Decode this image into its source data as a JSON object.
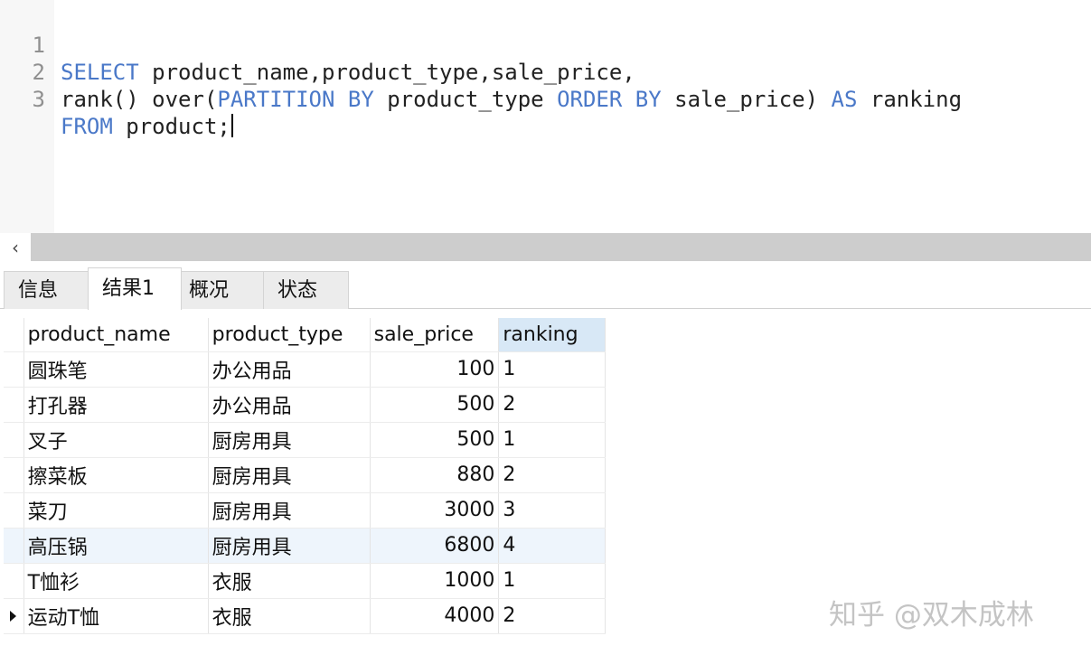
{
  "editor": {
    "lines": [
      {
        "number": "1",
        "tokens": [
          {
            "t": "SELECT",
            "kw": true
          },
          {
            "t": " product_name,product_type,sale_price,",
            "kw": false
          }
        ]
      },
      {
        "number": "2",
        "tokens": [
          {
            "t": "rank() over(",
            "kw": false
          },
          {
            "t": "PARTITION BY",
            "kw": true
          },
          {
            "t": " product_type ",
            "kw": false
          },
          {
            "t": "ORDER BY",
            "kw": true
          },
          {
            "t": " sale_price) ",
            "kw": false
          },
          {
            "t": "AS",
            "kw": true
          },
          {
            "t": " ranking",
            "kw": false
          }
        ]
      },
      {
        "number": "3",
        "tokens": [
          {
            "t": "FROM",
            "kw": true
          },
          {
            "t": " product;",
            "kw": false
          }
        ]
      }
    ]
  },
  "scrollbar": {
    "left_arrow": "‹"
  },
  "tabs": {
    "info": "信息",
    "result": "结果1",
    "overview": "概况",
    "status": "状态"
  },
  "grid": {
    "columns": [
      "product_name",
      "product_type",
      "sale_price",
      "ranking"
    ],
    "rows": [
      [
        "圆珠笔",
        "办公用品",
        "100",
        "1"
      ],
      [
        "打孔器",
        "办公用品",
        "500",
        "2"
      ],
      [
        "叉子",
        "厨房用具",
        "500",
        "1"
      ],
      [
        "擦菜板",
        "厨房用具",
        "880",
        "2"
      ],
      [
        "菜刀",
        "厨房用具",
        "3000",
        "3"
      ],
      [
        "高压锅",
        "厨房用具",
        "6800",
        "4"
      ],
      [
        "T恤衫",
        "衣服",
        "1000",
        "1"
      ],
      [
        "运动T恤",
        "衣服",
        "4000",
        "2"
      ]
    ],
    "selected_column": "ranking",
    "current_row_index": 7,
    "highlight_row_index": 5
  },
  "watermark": "知乎 @双木成林",
  "colors": {
    "keyword": "#4a78c8",
    "selected_header": "#d8e8f6"
  }
}
